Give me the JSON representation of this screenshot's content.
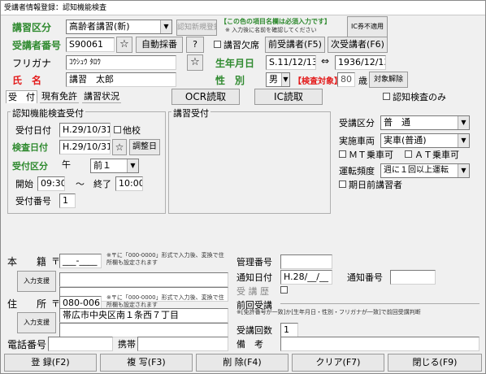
{
  "window": {
    "title": "受講者情報登録：認知機能検査"
  },
  "header": {
    "course_type_label": "講習区分",
    "course_type_value": "高齢者講習(新)",
    "course_type_btn": "認知新規登録",
    "required_note": "【この色の項目名欄は必須入力です】",
    "required_sub": "※ 入力後に名前を確認してください",
    "ic_card_btn": "IC券不適用",
    "student_no_label": "受講者番号",
    "student_no_value": "S90061",
    "star": "☆",
    "auto_number_btn": "自動採番",
    "help_btn": "?",
    "absent_label": "講習欠席",
    "prev_btn": "前受講者(F5)",
    "next_btn": "次受講者(F6)",
    "furigana_label": "フリガナ",
    "furigana_value": "ｺｳｼｭｳ ﾀﾛｳ",
    "birth_label": "生年月日",
    "birth_wareki": "S.11/12/13",
    "birth_arrow": "⇔",
    "birth_seireki": "1936/12/13",
    "name_label": "氏　名",
    "name_value": "講習　太郎",
    "gender_label": "性　別",
    "gender_value": "男",
    "exam_target": "【検査対象】",
    "age_value": "80",
    "age_unit": "歳",
    "exempt_btn": "対象解除"
  },
  "tabs": {
    "t1": "受　付",
    "t2": "現有免許",
    "t3": "講習状況",
    "ocr_btn": "OCR読取",
    "ic_btn": "IC読取",
    "cog_only": "認知検査のみ"
  },
  "cognitive": {
    "group_title": "認知機能検査受付",
    "accept_date_label": "受付日付",
    "accept_date": "H.29/10/31",
    "other_school": "他校",
    "exam_date_label": "検査日付",
    "exam_date": "H.29/10/31",
    "star": "☆",
    "adjust_btn": "調整日",
    "accept_div_label": "受付区分",
    "ampm": "午",
    "slot": "前１",
    "start_label": "開始",
    "start": "09:30",
    "tilde": "～",
    "end_label": "終了",
    "end": "10:00",
    "accept_no_label": "受付番号",
    "accept_no": "1"
  },
  "lecture": {
    "group_title": "講習受付"
  },
  "right": {
    "div_label": "受講区分",
    "div_value": "普　通",
    "vehicle_label": "実施車両",
    "vehicle_value": "実車(普通)",
    "mt": "ＭＴ乗車可",
    "at": "ＡＴ乗車可",
    "freq_label": "運転頻度",
    "freq_value": "週に１回以上運転",
    "early": "期日前講習者"
  },
  "address": {
    "honseki_label": "本　　籍",
    "postal_mark": "〒",
    "honseki_zip": "___-____",
    "zip_hint": "※〒に「000-0000」形式で入力後、変換で住所欄も設定されます",
    "input_support": "入力支援",
    "jusho_label": "住　　所",
    "jusho_zip": "080-0061",
    "jusho_value": "帯広市中央区南１条西７丁目",
    "phone_label": "電話番号",
    "mobile_label": "携帯"
  },
  "manage": {
    "mgmt_label": "管理番号",
    "notice_date_label": "通知日付",
    "notice_date": "H.28/__/__",
    "notice_no_label": "通知番号",
    "history_label": "受 講 歴",
    "prev_label": "前回受講",
    "prev_hint": "※[免許番号が一致]か[生年月日・性別・フリガナが一致]で前回受講判断",
    "count_label": "受講回数",
    "count_value": "1",
    "remarks_label": "備　考"
  },
  "footer": {
    "register": "登 録(F2)",
    "copy": "複 写(F3)",
    "delete": "削 除(F4)",
    "clear": "クリア(F7)",
    "close": "閉じる(F9)"
  }
}
